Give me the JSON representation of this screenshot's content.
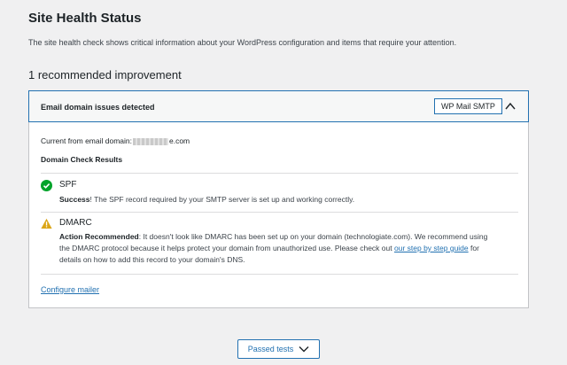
{
  "header": {
    "title": "Site Health Status",
    "description": "The site health check shows critical information about your WordPress configuration and items that require your attention."
  },
  "recommended": {
    "heading": "1 recommended improvement"
  },
  "issue": {
    "title": "Email domain issues detected",
    "badge": "WP Mail SMTP",
    "current_from_label": "Current from email domain:",
    "current_from_value_suffix": "e.com",
    "section_title": "Domain Check Results",
    "checks": [
      {
        "name": "SPF",
        "status": "success",
        "status_label": "Success",
        "message": "! The SPF record required by your SMTP server is set up and working correctly."
      },
      {
        "name": "DMARC",
        "status": "warning",
        "status_label": "Action Recommended",
        "message_line1": ": It doesn't look like DMARC has been set up on your domain (technologiate.com). We recommend using",
        "message_line2": "the DMARC protocol because it helps protect your domain from unauthorized use. Please check out",
        "link": "our step by step guide",
        "message_line2_end": " for",
        "message_line3": "details on how to add this record to your domain's DNS."
      }
    ],
    "configure_link": "Configure mailer"
  },
  "footer": {
    "passed_tests_label": "Passed tests"
  },
  "colors": {
    "accent": "#2271b1",
    "success": "#00a32a",
    "warning": "#dba617"
  }
}
